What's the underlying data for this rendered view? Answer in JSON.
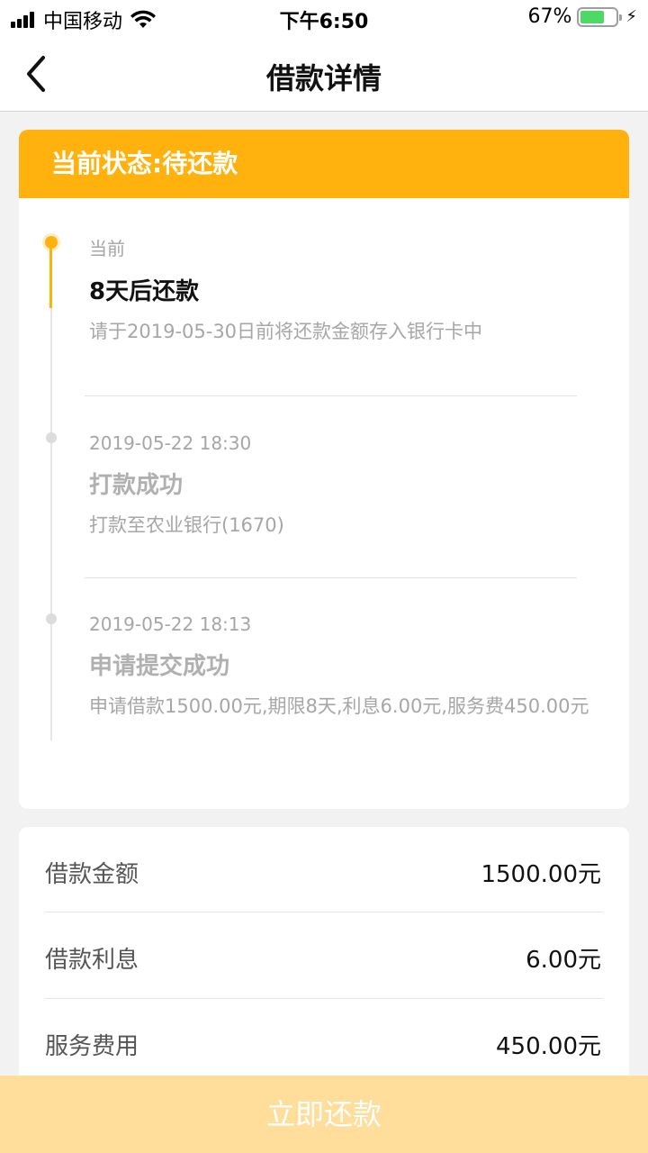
{
  "status_bar": {
    "carrier": "中国移动",
    "time": "下午6:50",
    "battery": "67%",
    "battery_level": 0.67,
    "icons": [
      "signal-icon",
      "wifi-icon",
      "battery-icon",
      "charging-icon"
    ]
  },
  "nav": {
    "title": "借款详情",
    "back_icon": "chevron-left-icon"
  },
  "status_card": {
    "header": "当前状态:待还款",
    "accent_color": "#ffb20d",
    "timeline": [
      {
        "label": "当前",
        "title": "8天后还款",
        "desc": "请于2019-05-30日前将还款金额存入银行卡中"
      },
      {
        "label": "2019-05-22 18:30",
        "title": "打款成功",
        "desc": "打款至农业银行(1670)"
      },
      {
        "label": "2019-05-22 18:13",
        "title": "申请提交成功",
        "desc": "申请借款1500.00元,期限8天,利息6.00元,服务费450.00元"
      }
    ]
  },
  "info": {
    "rows": [
      {
        "label": "借款金额",
        "value": "1500.00元"
      },
      {
        "label": "借款利息",
        "value": "6.00元"
      },
      {
        "label": "服务费用",
        "value": "450.00元"
      }
    ]
  },
  "footer": {
    "button_label": "立即还款",
    "button_color": "#ffdd9a"
  }
}
